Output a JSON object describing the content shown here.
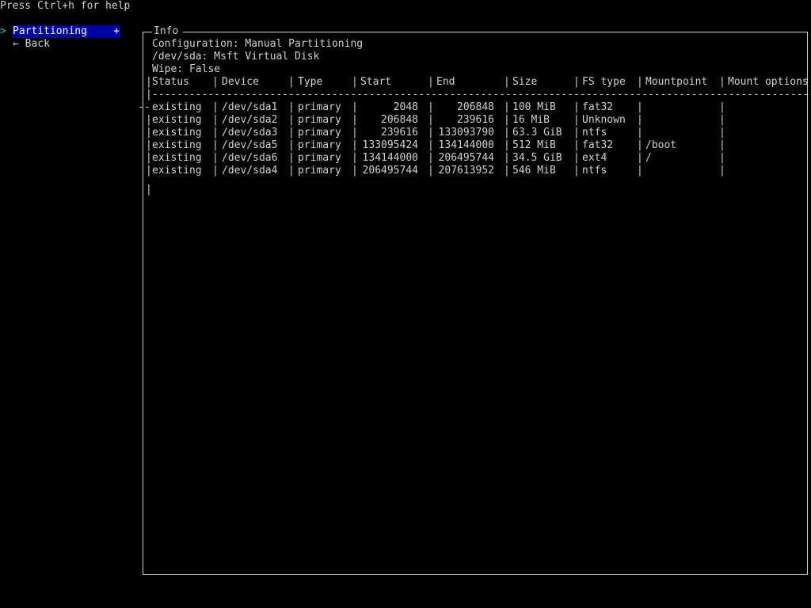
{
  "help_text": "Press Ctrl+h for help",
  "menu": {
    "chevron": ">",
    "partitioning_label": "Partitioning",
    "partitioning_plus": "+",
    "back_label": "← Back"
  },
  "info": {
    "title": "Info",
    "configuration": "Configuration: Manual Partitioning",
    "device": "/dev/sda: Msft Virtual Disk",
    "wipe": "Wipe: False"
  },
  "table": {
    "headers": [
      "Status",
      "Device",
      "Type",
      "Start",
      "End",
      "Size",
      "FS type",
      "Mountpoint",
      "Mount options"
    ],
    "separator": "|-------------------------------------------------------------------------------------------------------------------",
    "rows": [
      {
        "status": "existing",
        "device": "/dev/sda1",
        "type": "primary",
        "start": "2048",
        "end": "206848",
        "size": "100 MiB",
        "fs": "fat32",
        "mount": ""
      },
      {
        "status": "existing",
        "device": "/dev/sda2",
        "type": "primary",
        "start": "206848",
        "end": "239616",
        "size": "16 MiB",
        "fs": "Unknown",
        "mount": ""
      },
      {
        "status": "existing",
        "device": "/dev/sda3",
        "type": "primary",
        "start": "239616",
        "end": "133093790",
        "size": "63.3 GiB",
        "fs": "ntfs",
        "mount": ""
      },
      {
        "status": "existing",
        "device": "/dev/sda5",
        "type": "primary",
        "start": "133095424",
        "end": "134144000",
        "size": "512 MiB",
        "fs": "fat32",
        "mount": "/boot"
      },
      {
        "status": "existing",
        "device": "/dev/sda6",
        "type": "primary",
        "start": "134144000",
        "end": "206495744",
        "size": "34.5 GiB",
        "fs": "ext4",
        "mount": "/"
      },
      {
        "status": "existing",
        "device": "/dev/sda4",
        "type": "primary",
        "start": "206495744",
        "end": "207613952",
        "size": "546 MiB",
        "fs": "ntfs",
        "mount": ""
      }
    ]
  },
  "colors": {
    "background": "#000000",
    "text": "#d0d0d0",
    "highlight_bg": "#0000a8",
    "chevron": "#00c8c8"
  }
}
